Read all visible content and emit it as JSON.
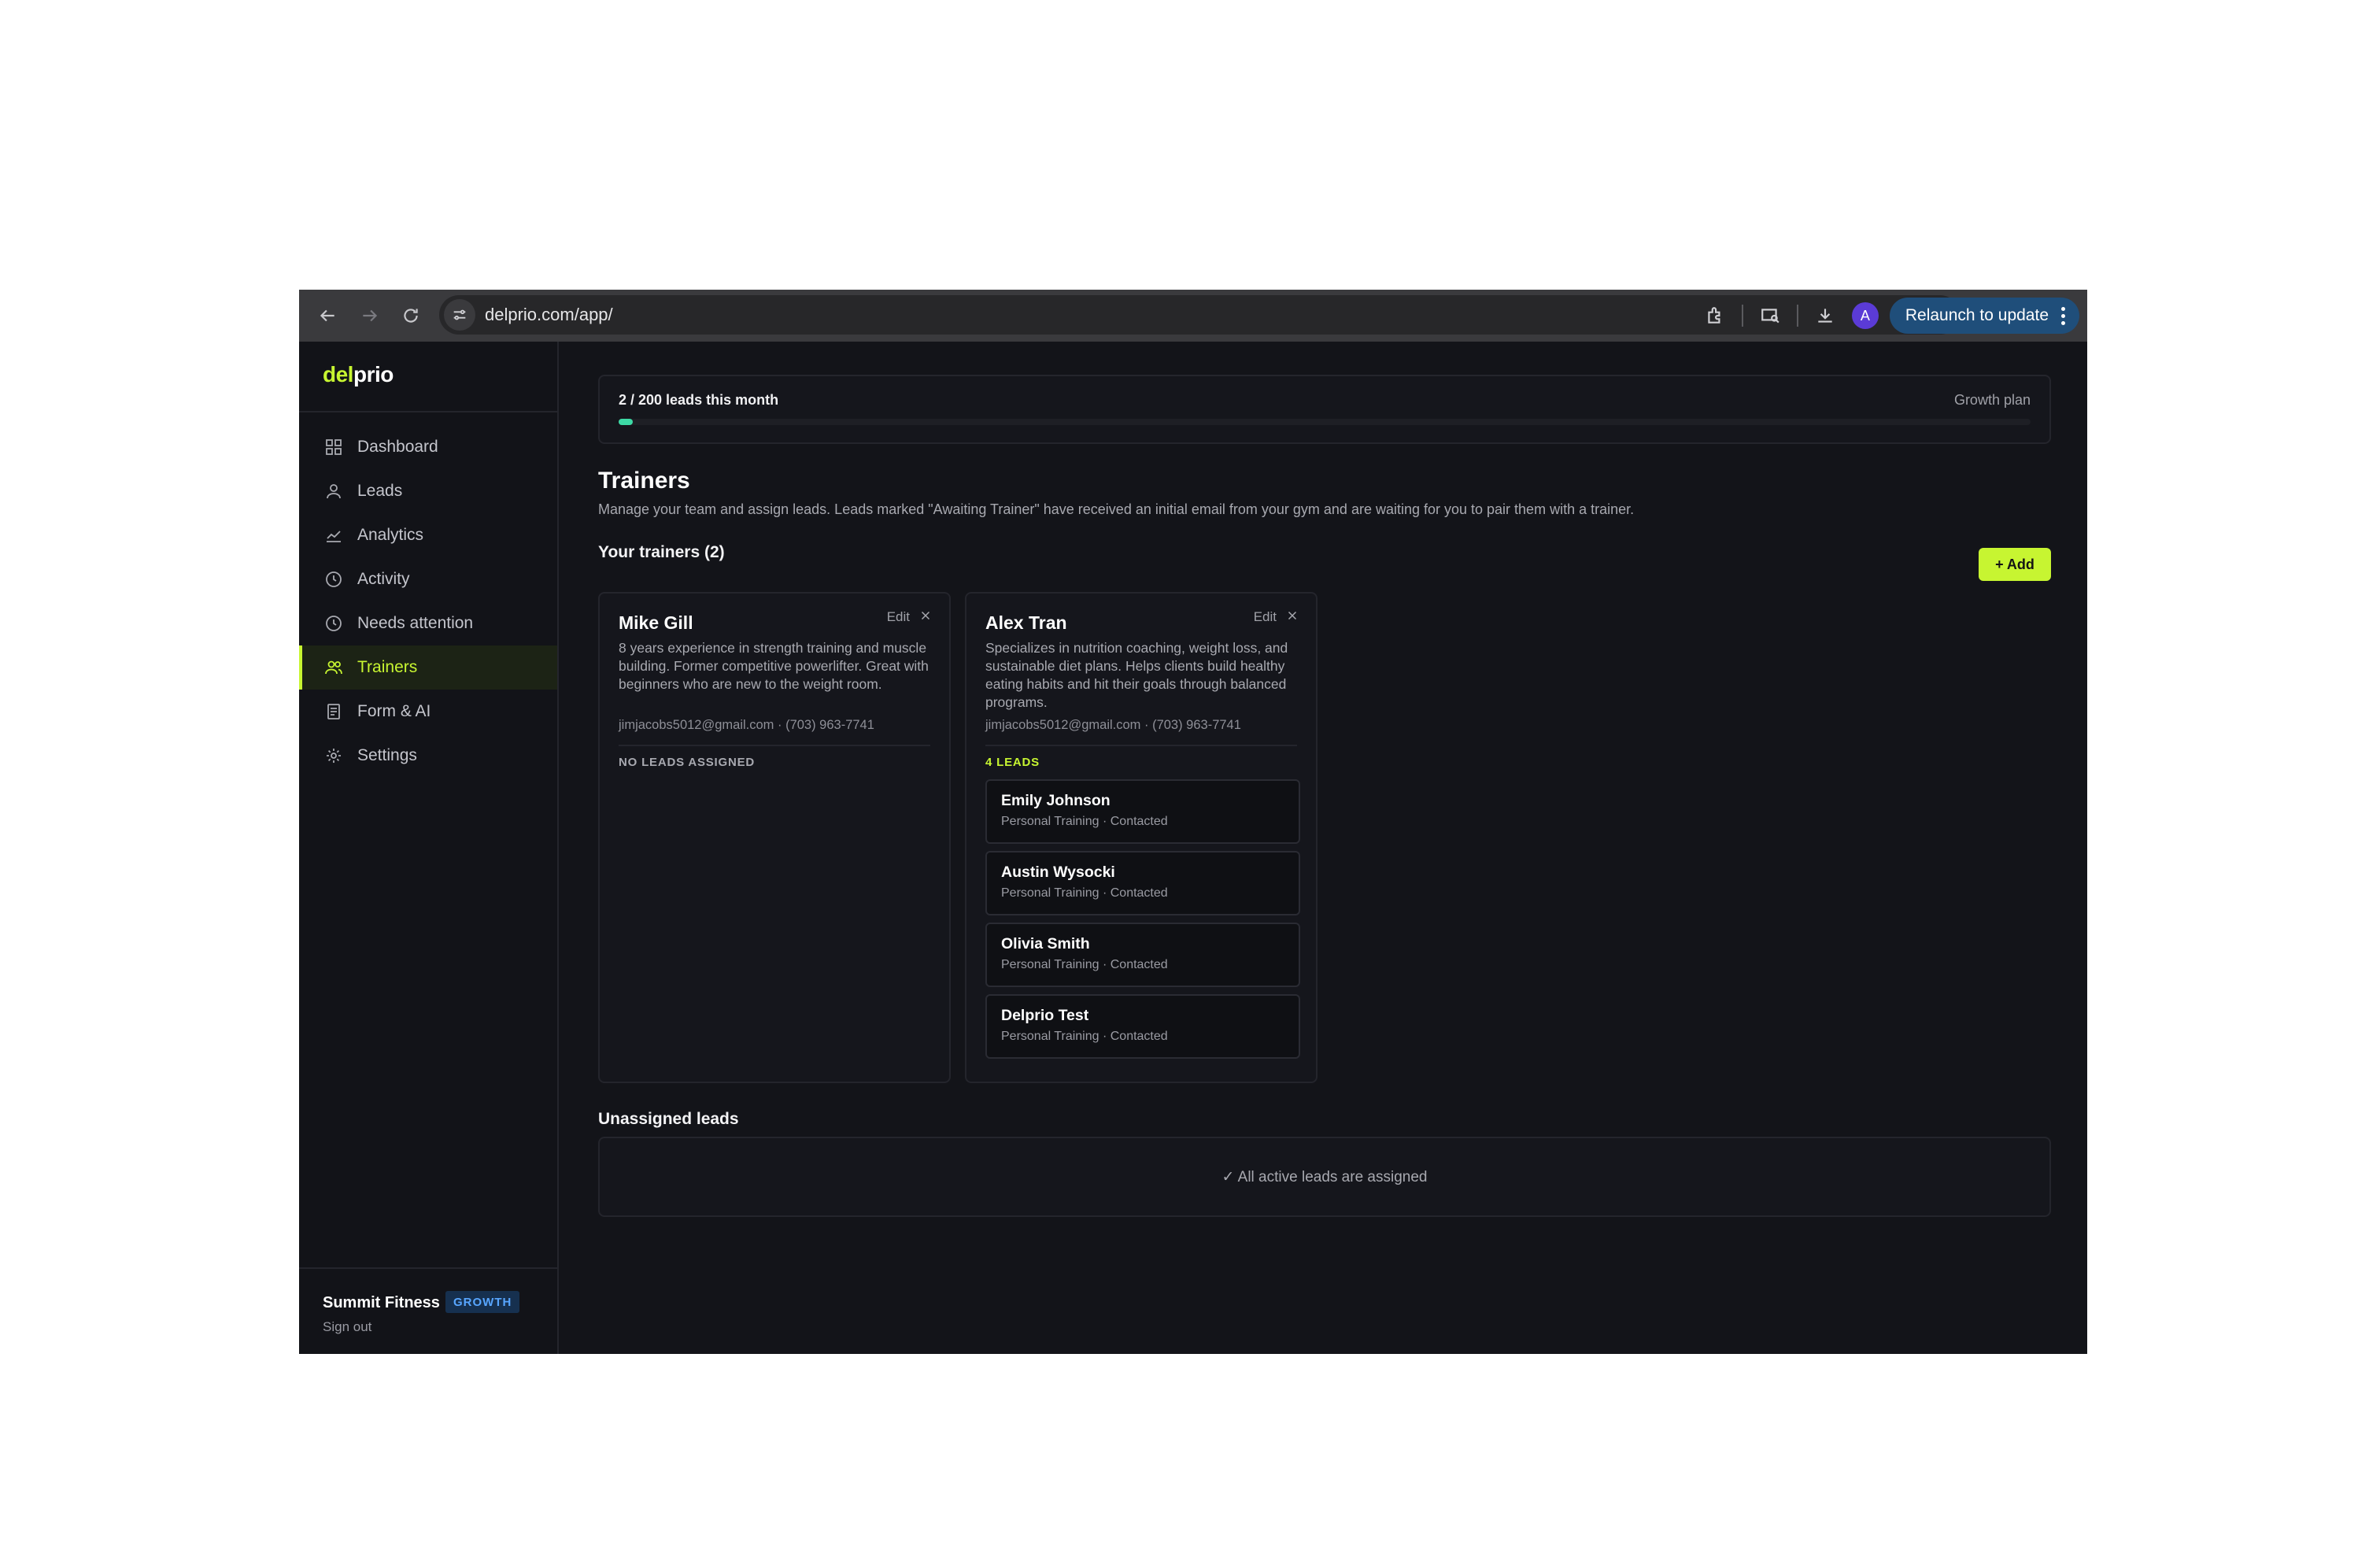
{
  "browser": {
    "url": "delprio.com/app/",
    "profile_initial": "A",
    "relaunch_label": "Relaunch to update"
  },
  "sidebar": {
    "logo": {
      "part1": "del",
      "part2": "prio"
    },
    "items": [
      {
        "label": "Dashboard",
        "icon": "grid-icon"
      },
      {
        "label": "Leads",
        "icon": "user-icon"
      },
      {
        "label": "Analytics",
        "icon": "chart-icon"
      },
      {
        "label": "Activity",
        "icon": "clock-icon"
      },
      {
        "label": "Needs attention",
        "icon": "clock-icon"
      },
      {
        "label": "Trainers",
        "icon": "users-icon",
        "active": true
      },
      {
        "label": "Form & AI",
        "icon": "document-icon"
      },
      {
        "label": "Settings",
        "icon": "gear-icon"
      }
    ],
    "org": {
      "name": "Summit Fitness",
      "plan_badge": "GROWTH",
      "sign_out": "Sign out"
    }
  },
  "usage": {
    "text": "2 / 200 leads this month",
    "plan": "Growth plan",
    "progress_fraction": 0.01
  },
  "page": {
    "title": "Trainers",
    "description": "Manage your team and assign leads. Leads marked \"Awaiting Trainer\" have received an initial email from your gym and are waiting for you to pair them with a trainer.",
    "trainers_heading": "Your trainers (2)",
    "add_label": "+ Add",
    "unassigned_heading": "Unassigned leads",
    "unassigned_message": "✓ All active leads are assigned"
  },
  "trainers": [
    {
      "name": "Mike Gill",
      "edit_label": "Edit",
      "bio": "8 years experience in strength training and muscle building. Former competitive powerlifter. Great with beginners who are new to the weight room.",
      "contact": "jimjacobs5012@gmail.com · (703) 963-7741",
      "leads_label": "NO LEADS ASSIGNED",
      "leads": []
    },
    {
      "name": "Alex Tran",
      "edit_label": "Edit",
      "bio": "Specializes in nutrition coaching, weight loss, and sustainable diet plans. Helps clients build healthy eating habits and hit their goals through balanced programs.",
      "contact": "jimjacobs5012@gmail.com · (703) 963-7741",
      "leads_label": "4 LEADS",
      "leads": [
        {
          "name": "Emily Johnson",
          "meta": "Personal Training · Contacted"
        },
        {
          "name": "Austin Wysocki",
          "meta": "Personal Training · Contacted"
        },
        {
          "name": "Olivia Smith",
          "meta": "Personal Training · Contacted"
        },
        {
          "name": "Delprio Test",
          "meta": "Personal Training · Contacted"
        }
      ]
    }
  ],
  "colors": {
    "accent": "#c7f531",
    "progress": "#3dd9a5",
    "badge": "#58a6ff"
  }
}
